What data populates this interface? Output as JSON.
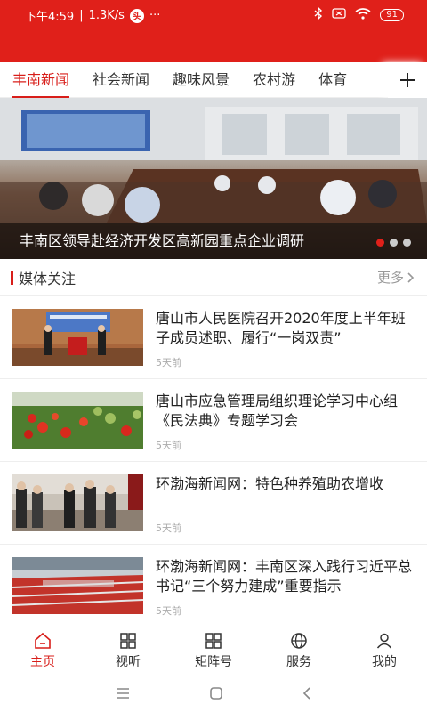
{
  "status": {
    "time": "下午4:59",
    "speed": "1.3K/s",
    "battery": "91",
    "dots": "···"
  },
  "tabs": [
    {
      "label": "丰南新闻"
    },
    {
      "label": "社会新闻"
    },
    {
      "label": "趣味风景"
    },
    {
      "label": "农村游"
    },
    {
      "label": "体育"
    }
  ],
  "banner": {
    "caption": "丰南区领导赴经济开发区高新园重点企业调研"
  },
  "section": {
    "title": "媒体关注",
    "more": "更多"
  },
  "news": [
    {
      "title": "唐山市人民医院召开2020年度上半年班子成员述职、履行“一岗双责”",
      "time": "5天前"
    },
    {
      "title": "唐山市应急管理局组织理论学习中心组《民法典》专题学习会",
      "time": "5天前"
    },
    {
      "title": "环渤海新闻网：特色种养殖助农增收",
      "time": "5天前"
    },
    {
      "title": "环渤海新闻网：丰南区深入践行习近平总书记“三个努力建成”重要指示",
      "time": "5天前"
    }
  ],
  "nav": [
    {
      "label": "主页",
      "icon": "home-icon"
    },
    {
      "label": "视听",
      "icon": "grid-icon"
    },
    {
      "label": "矩阵号",
      "icon": "grid-icon"
    },
    {
      "label": "服务",
      "icon": "globe-icon"
    },
    {
      "label": "我的",
      "icon": "user-icon"
    }
  ],
  "colors": {
    "brand": "#e0201a",
    "accent": "#d81e1a"
  }
}
